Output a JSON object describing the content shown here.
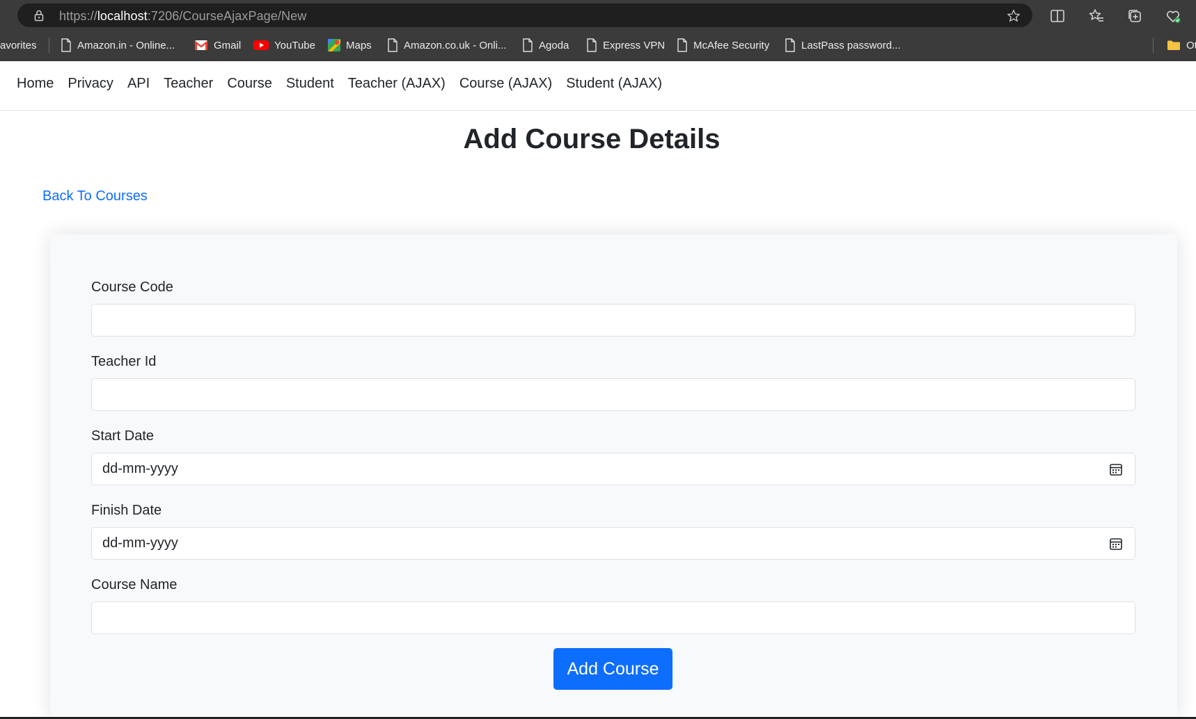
{
  "browser": {
    "url_scheme": "https://",
    "url_host": "localhost",
    "url_path": ":7206/CourseAjaxPage/New",
    "bookmarks": [
      {
        "label": "avorites",
        "icon": "none"
      },
      {
        "label": "Amazon.in - Online...",
        "icon": "page-icon"
      },
      {
        "label": "Gmail",
        "icon": "gmail-icon"
      },
      {
        "label": "YouTube",
        "icon": "youtube-icon"
      },
      {
        "label": "Maps",
        "icon": "maps-icon"
      },
      {
        "label": "Amazon.co.uk - Onli...",
        "icon": "page-icon"
      },
      {
        "label": "Agoda",
        "icon": "page-icon"
      },
      {
        "label": "Express VPN",
        "icon": "page-icon"
      },
      {
        "label": "McAfee Security",
        "icon": "page-icon"
      },
      {
        "label": "LastPass password...",
        "icon": "page-icon"
      },
      {
        "label": "Ot",
        "icon": "folder-icon"
      }
    ],
    "toolbar_icons": [
      "split-screen-icon",
      "favorites-icon",
      "collections-icon",
      "browser-essentials-icon"
    ]
  },
  "nav": {
    "links": [
      "Home",
      "Privacy",
      "API",
      "Teacher",
      "Course",
      "Student",
      "Teacher (AJAX)",
      "Course (AJAX)",
      "Student (AJAX)"
    ]
  },
  "page": {
    "title": "Add Course Details",
    "back_link": "Back To Courses"
  },
  "form": {
    "course_code_label": "Course Code",
    "course_code_value": "",
    "teacher_id_label": "Teacher Id",
    "teacher_id_value": "",
    "start_date_label": "Start Date",
    "start_date_placeholder": "dd-mm-yyyy",
    "finish_date_label": "Finish Date",
    "finish_date_placeholder": "dd-mm-yyyy",
    "course_name_label": "Course Name",
    "course_name_value": "",
    "submit_label": "Add Course"
  },
  "colors": {
    "primary": "#0d6efd",
    "link": "#0d6efd",
    "card_bg": "#f8f9fa",
    "chrome_bg": "#3b3b3b"
  }
}
